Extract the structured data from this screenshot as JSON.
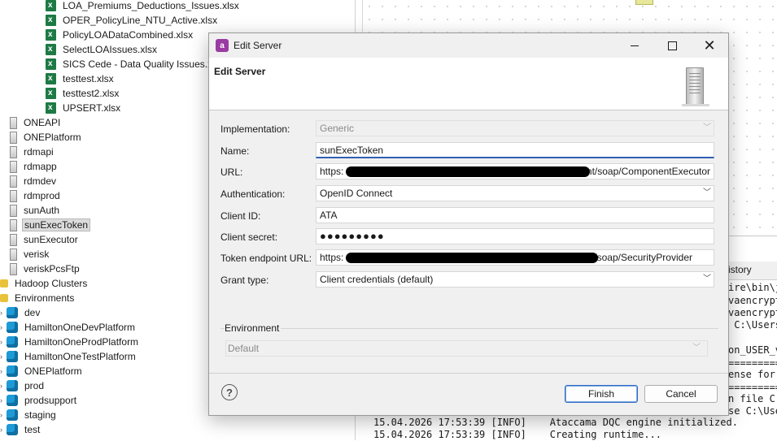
{
  "tree": {
    "files": [
      "LOA_Premiums_Deductions_Issues.xlsx",
      "OPER_PolicyLine_NTU_Active.xlsx",
      "PolicyLOADataCombined.xlsx",
      "SelectLOAIssues.xlsx",
      "SICS Cede - Data Quality Issues.xlsx",
      "testtest.xlsx",
      "testtest2.xlsx",
      "UPSERT.xlsx"
    ],
    "servers": [
      "ONEAPI",
      "ONEPlatform",
      "rdmapi",
      "rdmapp",
      "rdmdev",
      "rdmprod",
      "sunAuth",
      "sunExecToken",
      "sunExecutor",
      "verisk",
      "veriskPcsFtp"
    ],
    "selected_server": "sunExecToken",
    "hadoop_label": "Hadoop Clusters",
    "environments_label": "Environments",
    "environments": [
      "dev",
      "HamiltonOneDevPlatform",
      "HamiltonOneProdPlatform",
      "HamiltonOneTestPlatform",
      "ONEPlatform",
      "prod",
      "prodsupport",
      "staging",
      "test"
    ]
  },
  "console": {
    "history_tab": "istory",
    "right_fragments": [
      "ire\\bin\\java",
      "vaencrypt",
      "vaencrypt",
      " C:\\Users",
      "on_USER_v",
      "============",
      "ense for",
      "============",
      "n file C:",
      "se C:\\Users"
    ],
    "lines": [
      "15.04.2026 17:53:39 [INFO]    Ataccama DQC engine initialized.",
      "15.04.2026 17:53:39 [INFO]    Creating runtime..."
    ]
  },
  "dialog": {
    "window_title": "Edit Server",
    "app_icon_text": "a",
    "header_title": "Edit Server",
    "labels": {
      "implementation": "Implementation:",
      "name": "Name:",
      "url": "URL:",
      "authentication": "Authentication:",
      "client_id": "Client ID:",
      "client_secret": "Client secret:",
      "token_endpoint": "Token endpoint URL:",
      "grant_type": "Grant type:"
    },
    "values": {
      "implementation": "Generic",
      "name": "sunExecToken",
      "url_prefix": "https:",
      "url_suffix": "ionent/soap/ComponentExecutor",
      "authentication": "OpenID Connect",
      "client_id": "ATA",
      "client_secret": "●●●●●●●●●",
      "token_prefix": "https:",
      "token_suffix": "/soap/SecurityProvider",
      "grant_type": "Client credentials (default)"
    },
    "environment_group_title": "Environment",
    "environment_value": "Default",
    "help_symbol": "?",
    "finish_label": "Finish",
    "cancel_label": "Cancel"
  }
}
